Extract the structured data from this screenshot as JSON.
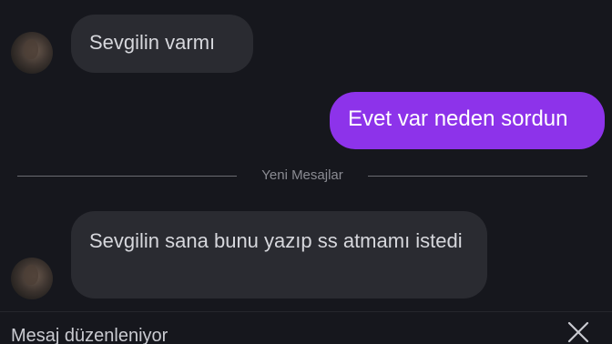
{
  "messages": [
    {
      "side": "incoming",
      "text": "Sevgilin varmı"
    },
    {
      "side": "outgoing",
      "text": "Evet var neden sordun"
    },
    {
      "side": "incoming",
      "text": "Sevgilin sana bunu yazıp ss atmamı istedi"
    }
  ],
  "divider": {
    "label": "Yeni Mesajlar"
  },
  "edit_bar": {
    "label": "Mesaj düzenleniyor",
    "close_icon": "close-icon"
  },
  "colors": {
    "background": "#16171d",
    "incoming_bubble": "#2a2b31",
    "outgoing_bubble": "#8d33ea"
  }
}
